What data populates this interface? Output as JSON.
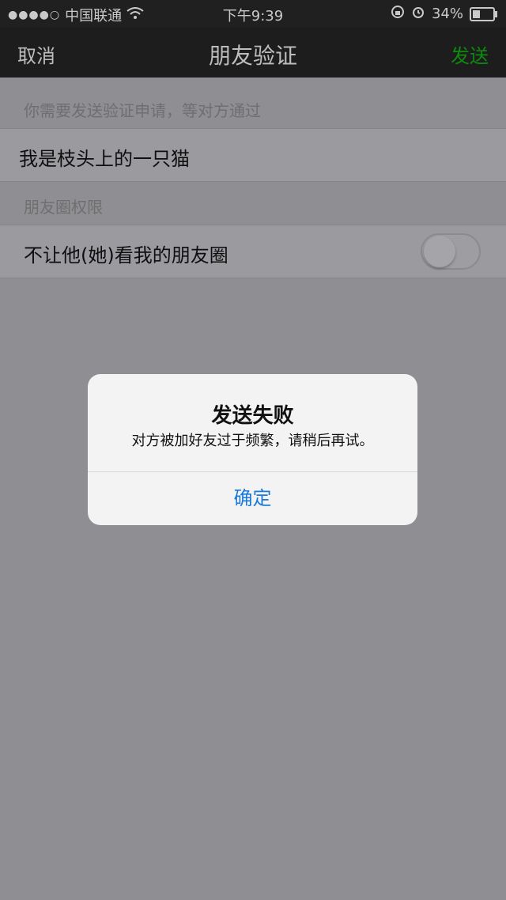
{
  "status_bar": {
    "signal_dots": "●●●●○",
    "carrier": "中国联通",
    "wifi_icon": "wifi-icon",
    "time": "下午9:39",
    "battery_percent": "34%"
  },
  "navbar": {
    "cancel_label": "取消",
    "title": "朋友验证",
    "send_label": "发送",
    "send_color": "#0f8a0f"
  },
  "verification": {
    "section_label": "你需要发送验证申请，等对方通过",
    "message_value": "我是枝头上的一只猫"
  },
  "moments": {
    "section_label": "朋友圈权限",
    "hide_label": "不让他(她)看我的朋友圈",
    "hide_enabled": false
  },
  "alert": {
    "title": "发送失败",
    "message": "对方被加好友过于频繁，请稍后再试。",
    "confirm_label": "确定",
    "confirm_color": "#1a7ad8"
  }
}
